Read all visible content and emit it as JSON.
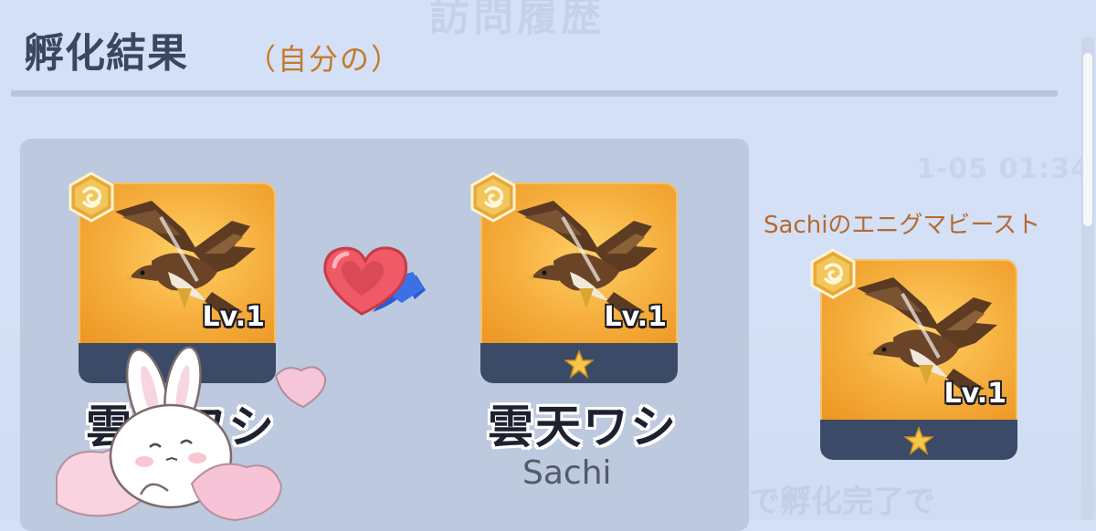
{
  "header": {
    "title": "孵化結果",
    "subtitle": "（自分の）"
  },
  "colors": {
    "accent_orange": "#c47a2b",
    "card_gold": "#f5ad3c",
    "card_footer": "#3b4a66",
    "panel": "#bcc9de"
  },
  "parents": {
    "left": {
      "name": "雲天ワシ",
      "level": "Lv.1",
      "icon": "eagle-icon"
    },
    "right": {
      "name": "雲天ワシ",
      "level": "Lv.1",
      "owner": "Sachi",
      "icon": "eagle-icon"
    },
    "link_icon": "heart-link-icon"
  },
  "result": {
    "label": "Sachiのエニグマビースト",
    "level": "Lv.1",
    "icon": "eagle-icon"
  },
  "decor": {
    "sticker": "bunny-hug-sticker"
  }
}
